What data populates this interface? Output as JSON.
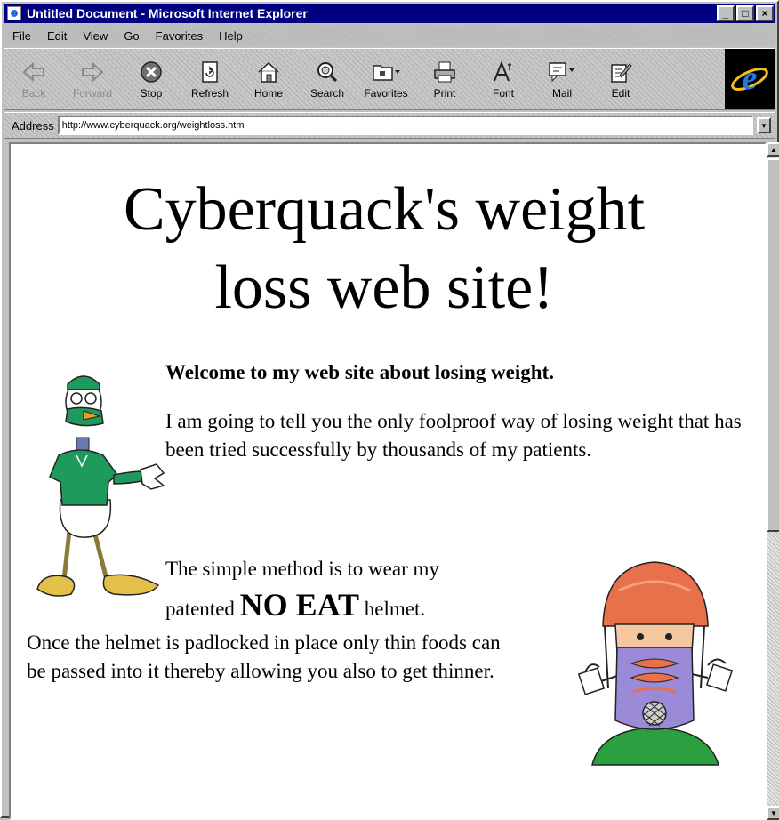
{
  "window": {
    "title": "Untitled Document - Microsoft Internet Explorer",
    "controls": [
      "_",
      "□",
      "×"
    ]
  },
  "menu": [
    "File",
    "Edit",
    "View",
    "Go",
    "Favorites",
    "Help"
  ],
  "toolbar": [
    {
      "label": "Back",
      "icon": "back-arrow-icon",
      "enabled": false
    },
    {
      "label": "Forward",
      "icon": "forward-arrow-icon",
      "enabled": false
    },
    {
      "label": "Stop",
      "icon": "stop-icon",
      "enabled": true
    },
    {
      "label": "Refresh",
      "icon": "refresh-icon",
      "enabled": true
    },
    {
      "label": "Home",
      "icon": "home-icon",
      "enabled": true
    },
    {
      "label": "Search",
      "icon": "search-icon",
      "enabled": true
    },
    {
      "label": "Favorites",
      "icon": "favorites-icon",
      "enabled": true
    },
    {
      "label": "Print",
      "icon": "print-icon",
      "enabled": true
    },
    {
      "label": "Font",
      "icon": "font-icon",
      "enabled": true
    },
    {
      "label": "Mail",
      "icon": "mail-icon",
      "enabled": true
    },
    {
      "label": "Edit",
      "icon": "edit-icon",
      "enabled": true
    }
  ],
  "address": {
    "label": "Address",
    "url": "http://www.cyberquack.org/weightloss.htm"
  },
  "page": {
    "heading_line1": "Cyberquack's weight",
    "heading_line2": "loss web site!",
    "welcome": "Welcome to my web site about losing weight.",
    "intro": "I am going to tell you the only foolproof way of losing weight that has been tried successfully by thousands of my patients.",
    "simple": "The simple method is to wear my",
    "patented_pre": "patented",
    "no_eat": "NO EAT",
    "patented_post": "helmet.",
    "body": "Once the helmet is padlocked in place only thin foods can be passed into it thereby allowing you also to get thinner."
  },
  "colors": {
    "title_bar": "#000080",
    "chrome": "#c0c0c0",
    "duck_shirt": "#1e9a5c",
    "duck_feet": "#e3c04a",
    "helmet": "#e8704a",
    "mask": "#9b8ad8"
  }
}
